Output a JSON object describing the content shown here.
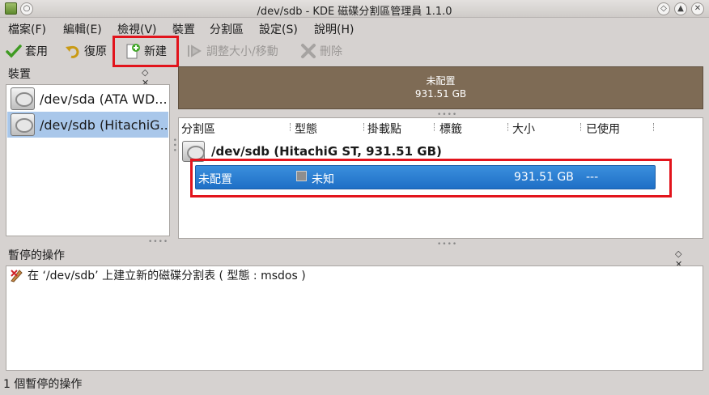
{
  "window": {
    "title": "/dev/sdb - KDE 磁碟分割區管理員 1.1.0",
    "btn_min": "◇",
    "btn_max": "▲",
    "btn_close": "✕"
  },
  "menu": {
    "file": "檔案(F)",
    "edit": "編輯(E)",
    "view": "檢視(V)",
    "device": "裝置",
    "partition": "分割區",
    "settings": "設定(S)",
    "help": "說明(H)"
  },
  "toolbar": {
    "apply": "套用",
    "undo": "復原",
    "new": "新建",
    "resize": "調整大小/移動",
    "delete": "刪除"
  },
  "devices_panel": {
    "title": "裝置",
    "dock_btns": "◇ ✕",
    "items": [
      {
        "label": "/dev/sda (ATA WD..."
      },
      {
        "label": "/dev/sdb (HitachiG..."
      }
    ]
  },
  "disk_map": {
    "label": "未配置",
    "size": "931.51 GB"
  },
  "partition_table": {
    "columns": {
      "partition": "分割區",
      "type": "型態",
      "mount": "掛載點",
      "label": "標籤",
      "size": "大小",
      "used": "已使用"
    },
    "disk_label": "/dev/sdb (HitachiG ST, 931.51 GB)",
    "row": {
      "partition": "未配置",
      "type": "未知",
      "size": "931.51 GB",
      "used": "---"
    }
  },
  "pending_panel": {
    "title": "暫停的操作",
    "dock_btns": "◇ ✕",
    "items": [
      {
        "text": "在 ‘/dev/sdb’ 上建立新的磁碟分割表 ( 型態 : msdos )"
      }
    ]
  },
  "status": {
    "text": "1 個暫停的操作"
  },
  "colors": {
    "selection": "#1f6fc6",
    "unallocated": "#7e6b55",
    "highlight": "#e2141c"
  }
}
